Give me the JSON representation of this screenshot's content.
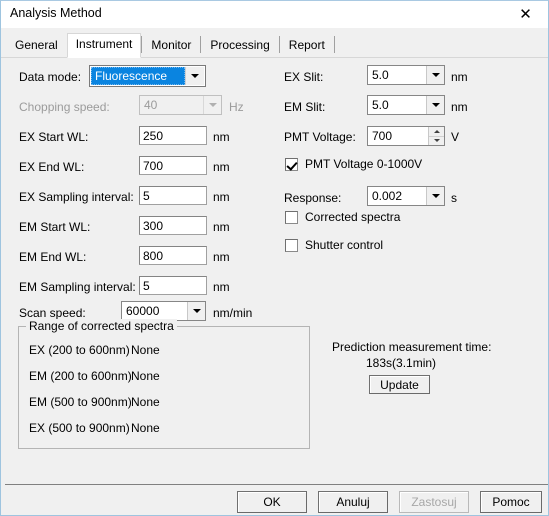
{
  "window": {
    "title": "Analysis Method",
    "close_icon": "close-icon"
  },
  "tabs": [
    {
      "label": "General",
      "selected": false
    },
    {
      "label": "Instrument",
      "selected": true
    },
    {
      "label": "Monitor",
      "selected": false
    },
    {
      "label": "Processing",
      "selected": false
    },
    {
      "label": "Report",
      "selected": false
    }
  ],
  "left_column": {
    "data_mode": {
      "label": "Data mode:",
      "value": "Fluorescence",
      "unit": ""
    },
    "chopping_speed": {
      "label": "Chopping speed:",
      "value": "40",
      "unit": "Hz"
    },
    "ex_start_wl": {
      "label": "EX Start WL:",
      "value": "250",
      "unit": "nm"
    },
    "ex_end_wl": {
      "label": "EX End WL:",
      "value": "700",
      "unit": "nm"
    },
    "ex_sampling_interval": {
      "label": "EX Sampling interval:",
      "value": "5",
      "unit": "nm"
    },
    "em_start_wl": {
      "label": "EM Start WL:",
      "value": "300",
      "unit": "nm"
    },
    "em_end_wl": {
      "label": "EM End WL:",
      "value": "800",
      "unit": "nm"
    },
    "em_sampling_interval": {
      "label": "EM Sampling interval:",
      "value": "5",
      "unit": "nm"
    },
    "scan_speed": {
      "label": "Scan speed:",
      "value": "60000",
      "unit": "nm/min"
    }
  },
  "right_column": {
    "ex_slit": {
      "label": "EX Slit:",
      "value": "5.0",
      "unit": "nm"
    },
    "em_slit": {
      "label": "EM Slit:",
      "value": "5.0",
      "unit": "nm"
    },
    "pmt_voltage": {
      "label": "PMT Voltage:",
      "value": "700",
      "unit": "V"
    },
    "pmt_range": {
      "label": "PMT Voltage 0-1000V",
      "checked": true
    },
    "response": {
      "label": "Response:",
      "value": "0.002",
      "unit": "s"
    },
    "corrected_spectra": {
      "label": "Corrected spectra",
      "checked": false
    },
    "shutter_control": {
      "label": "Shutter control",
      "checked": false
    }
  },
  "range_group": {
    "title": "Range of corrected spectra",
    "rows": [
      {
        "range": "EX (200 to 600nm)",
        "value": "None"
      },
      {
        "range": "EM (200 to 600nm)",
        "value": "None"
      },
      {
        "range": "EM (500 to 900nm)",
        "value": "None"
      },
      {
        "range": "EX (500 to 900nm)",
        "value": "None"
      }
    ]
  },
  "prediction": {
    "label": "Prediction measurement time:",
    "value": "183s(3.1min)",
    "update_label": "Update"
  },
  "footer": {
    "ok": "OK",
    "cancel": "Anuluj",
    "apply": "Zastosuj",
    "help": "Pomoc"
  },
  "colors": {
    "accent": "#0a84e0",
    "dialog_bg": "#f0f0f0",
    "titlebar_bg": "#ffffff",
    "border": "#9ec4df",
    "disabled_text": "#9b9b9b"
  }
}
